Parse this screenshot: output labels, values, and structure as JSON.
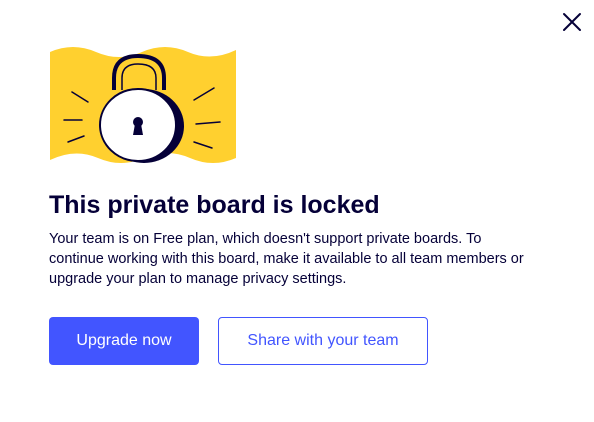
{
  "modal": {
    "title": "This private board is locked",
    "description": "Your team is on Free plan, which doesn't support private boards. To continue working with this board, make it available to all team members or upgrade your plan to manage privacy settings.",
    "close_icon": "close-icon",
    "illustration_icon": "padlock-icon"
  },
  "actions": {
    "upgrade_label": "Upgrade now",
    "share_label": "Share with your team"
  },
  "colors": {
    "accent": "#4255ff",
    "text": "#050038",
    "illustration_yellow": "#ffd02f"
  }
}
